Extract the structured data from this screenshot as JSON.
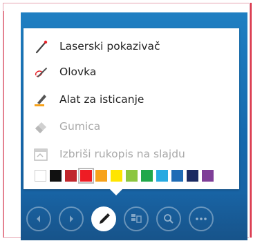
{
  "menu": {
    "items": [
      {
        "label": "Laserski pokazivač",
        "icon": "laser-pointer-icon",
        "enabled": true
      },
      {
        "label": "Olovka",
        "icon": "pen-icon",
        "enabled": true
      },
      {
        "label": "Alat za isticanje",
        "icon": "highlighter-icon",
        "enabled": true
      },
      {
        "label": "Gumica",
        "icon": "eraser-icon",
        "enabled": false
      },
      {
        "label": "Izbriši rukopis na slajdu",
        "icon": "erase-ink-icon",
        "enabled": false
      }
    ],
    "colors": [
      "#ffffff",
      "#111111",
      "#c0262c",
      "#ee1c24",
      "#f7a21b",
      "#ffe500",
      "#8cc63f",
      "#21a84b",
      "#27aae1",
      "#1f6bb5",
      "#1b2a63",
      "#7f3f98"
    ],
    "selected_color_index": 3
  },
  "toolbar": {
    "buttons": [
      {
        "name": "previous-slide-button",
        "icon": "arrow-left-icon",
        "active": false
      },
      {
        "name": "next-slide-button",
        "icon": "arrow-right-icon",
        "active": false
      },
      {
        "name": "pen-tools-button",
        "icon": "pen-icon",
        "active": true
      },
      {
        "name": "see-all-slides-button",
        "icon": "slides-grid-icon",
        "active": false
      },
      {
        "name": "zoom-button",
        "icon": "magnifier-icon",
        "active": false
      },
      {
        "name": "more-options-button",
        "icon": "ellipsis-icon",
        "active": false
      }
    ]
  }
}
